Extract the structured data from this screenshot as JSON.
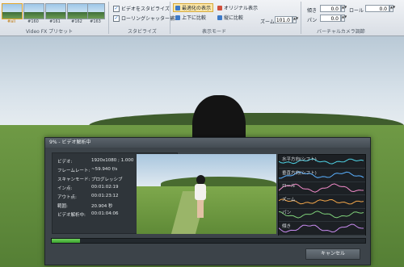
{
  "ribbon": {
    "presets": {
      "section_label": "Video FX プリセット",
      "items": [
        {
          "label": "#all",
          "selected": true
        },
        {
          "label": "#160"
        },
        {
          "label": "#161"
        },
        {
          "label": "#162"
        },
        {
          "label": "#163"
        }
      ]
    },
    "stabilize": {
      "section_label": "スタビライズ",
      "stabilize_label": "ビデオをスタビライズ",
      "stabilize_checked": true,
      "rolling_label": "ローリングシャッター補正",
      "rolling_checked": true
    },
    "view_mode": {
      "section_label": "表示モード",
      "optimized_label": "最適化の表示",
      "original_label": "オリジナル表示",
      "vertical_label": "上下に比較",
      "side_label": "縦に比較",
      "zoom_label": "ズーム",
      "zoom_value": "101.0"
    },
    "virtual_camera": {
      "section_label": "バーチャルカメラ調節",
      "tilt_label": "傾き",
      "tilt_value": "0.0",
      "pan_label": "パン",
      "pan_value": "0.0",
      "roll_label": "ロール",
      "roll_value": "0.0"
    }
  },
  "dialog": {
    "title": "9% - ビデオ解析中",
    "info": [
      {
        "label": "ビデオ:",
        "value": "1920x1080 ; 1.000"
      },
      {
        "label": "フレームレート:",
        "value": "~59.940 f/s"
      },
      {
        "label": "スキャンモード:",
        "value": "プログレッシブ"
      },
      {
        "label": "イン点:",
        "value": "00:01:02:19"
      },
      {
        "label": "アウト点:",
        "value": "00:01:23:12"
      },
      {
        "label": "範囲:",
        "value": "20.904 秒"
      },
      {
        "label": "ビデオ解析中:",
        "value": "00:01:04:06"
      }
    ],
    "graphs": [
      {
        "label": "水平方向(シフト)",
        "color": "#4fd3e6"
      },
      {
        "label": "垂直方向(シフト)",
        "color": "#5ab0ff"
      },
      {
        "label": "ロール",
        "color": "#f08ac8"
      },
      {
        "label": "ズーム",
        "color": "#f2a64a"
      },
      {
        "label": "パン",
        "color": "#7fd07a"
      },
      {
        "label": "傾き",
        "color": "#c98cf0"
      }
    ],
    "progress": 0.09,
    "cancel_label": "キャンセル"
  }
}
